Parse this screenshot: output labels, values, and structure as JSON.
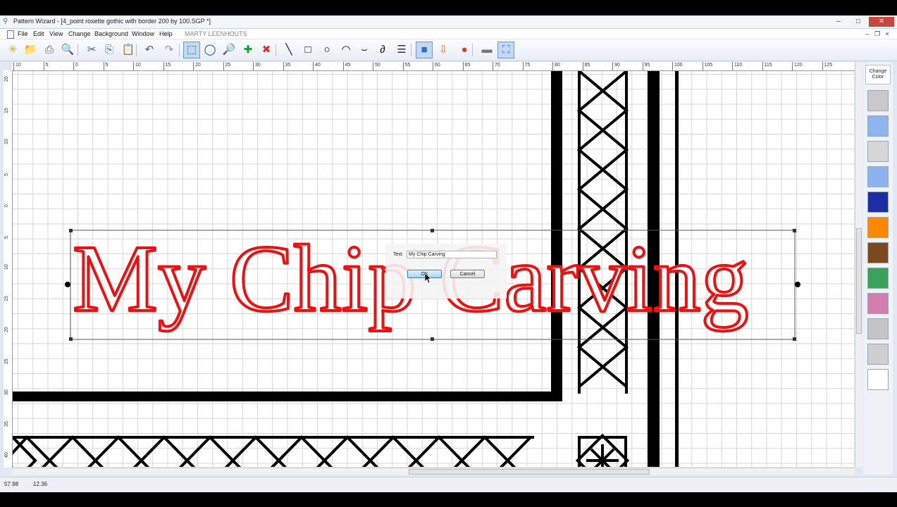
{
  "window": {
    "title": "Pattern Wizard - [4_point rosette gothic with border 200 by 100.SGP *]",
    "controls": {
      "minimize": "–",
      "maximize": "□",
      "close": "✕"
    }
  },
  "menu": {
    "items": [
      "File",
      "Edit",
      "View",
      "Change",
      "Background",
      "Window",
      "Help"
    ],
    "user": "MARTY LEENHOUTS",
    "mdi_controls": {
      "minimize": "–",
      "restore": "❐",
      "close": "×"
    }
  },
  "toolbar": {
    "buttons": [
      {
        "icon": "new-icon",
        "glyph": "✳",
        "color": "#e0a800"
      },
      {
        "icon": "open-folder-icon",
        "glyph": "📁",
        "color": "#e3b431"
      },
      {
        "icon": "print-icon",
        "glyph": "⎙",
        "color": "#555555"
      },
      {
        "icon": "print-preview-icon",
        "glyph": "🔍",
        "color": "#3a6fb0"
      },
      {
        "icon": "cut-icon",
        "glyph": "✂",
        "color": "#3b5f8f"
      },
      {
        "icon": "copy-icon",
        "glyph": "⎘",
        "color": "#3b6fb0"
      },
      {
        "icon": "paste-icon",
        "glyph": "📋",
        "color": "#b07b2e"
      },
      {
        "icon": "undo-icon",
        "glyph": "↶",
        "color": "#2c64b3"
      },
      {
        "icon": "redo-icon",
        "glyph": "↷",
        "color": "#8a96a8"
      },
      {
        "icon": "select-rectangle-icon",
        "glyph": "⬚",
        "color": "#1d3d6e",
        "active": true
      },
      {
        "icon": "lasso-icon",
        "glyph": "◯",
        "color": "#1d3d6e"
      },
      {
        "icon": "zoom-icon",
        "glyph": "🔎",
        "color": "#2d6bc4"
      },
      {
        "icon": "add-icon",
        "glyph": "✚",
        "color": "#12a12a"
      },
      {
        "icon": "delete-icon",
        "glyph": "✖",
        "color": "#d9312b"
      },
      {
        "icon": "line-tool-icon",
        "glyph": "╲",
        "color": "#111111"
      },
      {
        "icon": "rectangle-tool-icon",
        "glyph": "□",
        "color": "#111111"
      },
      {
        "icon": "ellipse-tool-icon",
        "glyph": "○",
        "color": "#111111"
      },
      {
        "icon": "arc-tool-icon",
        "glyph": "◠",
        "color": "#111111"
      },
      {
        "icon": "curve-tool-icon",
        "glyph": "⌣",
        "color": "#111111"
      },
      {
        "icon": "freehand-tool-icon",
        "glyph": "∂",
        "color": "#111111"
      },
      {
        "icon": "text-tool-icon",
        "glyph": "☰",
        "color": "#333333"
      },
      {
        "icon": "fill-color-icon",
        "glyph": "■",
        "color": "#1f6fd6",
        "active": true
      },
      {
        "icon": "import-icon",
        "glyph": "⇩",
        "color": "#e36a1b"
      },
      {
        "icon": "record-icon",
        "glyph": "●",
        "color": "#e33b1f"
      },
      {
        "icon": "background-icon",
        "glyph": "▬",
        "color": "#777777"
      },
      {
        "icon": "zoom-fit-icon",
        "glyph": "⛶",
        "color": "#2d6bc4",
        "active": true
      }
    ]
  },
  "rulers": {
    "top": [
      "10",
      "5",
      "0",
      "5",
      "10",
      "15",
      "20",
      "25",
      "30",
      "35",
      "40",
      "45",
      "50",
      "55",
      "60",
      "65",
      "70",
      "75",
      "80",
      "85",
      "90",
      "95",
      "100",
      "105",
      "110",
      "115",
      "120",
      "125"
    ],
    "left": [
      "20",
      "15",
      "10",
      "5",
      "0",
      "5",
      "10",
      "15",
      "20",
      "25",
      "30",
      "35",
      "40"
    ]
  },
  "canvas": {
    "text_object": "My Chip Carving",
    "text_color": "#ee1111",
    "border_color": "#000000"
  },
  "dialog": {
    "label": "Text",
    "value": "My Chip Carving",
    "ok_label": "OK",
    "cancel_label": "Cancel"
  },
  "palette": {
    "change_color_label": "Change Color",
    "swatches": [
      "#c9c9c9",
      "#8fb4ee",
      "#d6d6d6",
      "#8cb2ef",
      "#1b2fa3",
      "#ff8800",
      "#7a4a1e",
      "#3aa05a",
      "#d27fb0",
      "#c4c4c4",
      "#cfcfcf",
      "#ffffff"
    ]
  },
  "status": {
    "x": "57.98",
    "y": "12.36"
  }
}
